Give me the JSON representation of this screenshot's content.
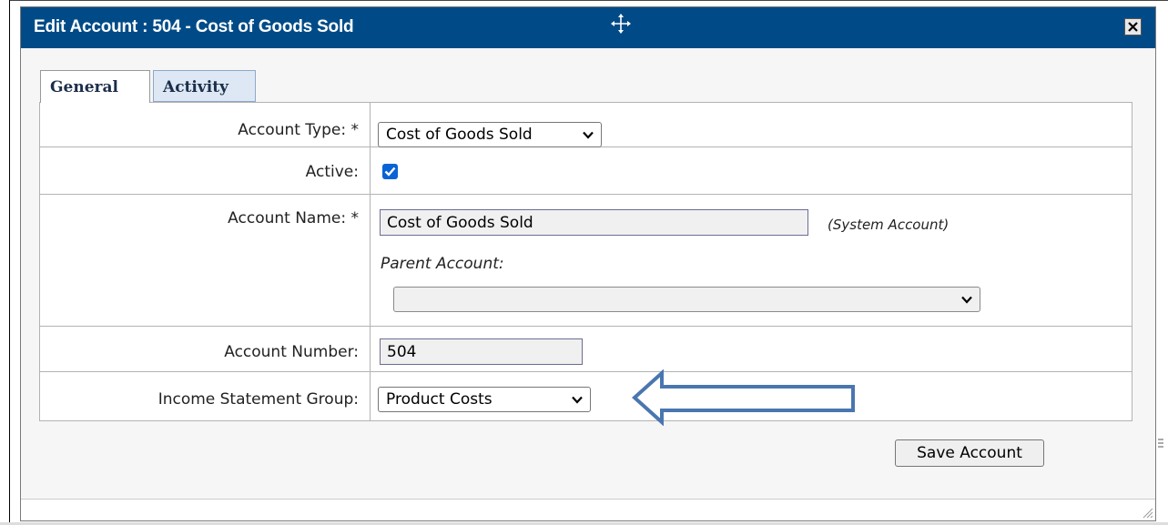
{
  "dialog": {
    "title": "Edit Account : 504 - Cost of Goods Sold",
    "icons": {
      "move": "move-icon",
      "close": "close-icon"
    }
  },
  "tabs": [
    {
      "label": "General",
      "active": true
    },
    {
      "label": "Activity",
      "active": false
    }
  ],
  "form": {
    "account_type": {
      "label": "Account Type: *",
      "value": "Cost of Goods Sold"
    },
    "active": {
      "label": "Active:",
      "checked": true
    },
    "account_name": {
      "label": "Account Name: *",
      "value": "Cost of Goods Sold",
      "note": "(System Account)"
    },
    "parent_account": {
      "label": "Parent Account:",
      "value": ""
    },
    "account_number": {
      "label": "Account Number:",
      "value": "504"
    },
    "income_statement_group": {
      "label": "Income Statement Group:",
      "value": "Product Costs"
    }
  },
  "annotation": {
    "type": "arrow-left-outline",
    "color": "#4a76b0"
  },
  "buttons": {
    "save": "Save Account"
  },
  "colors": {
    "titlebar": "#004b87",
    "checkbox": "#0a63d6",
    "activity_tab": "#dde8f4"
  }
}
